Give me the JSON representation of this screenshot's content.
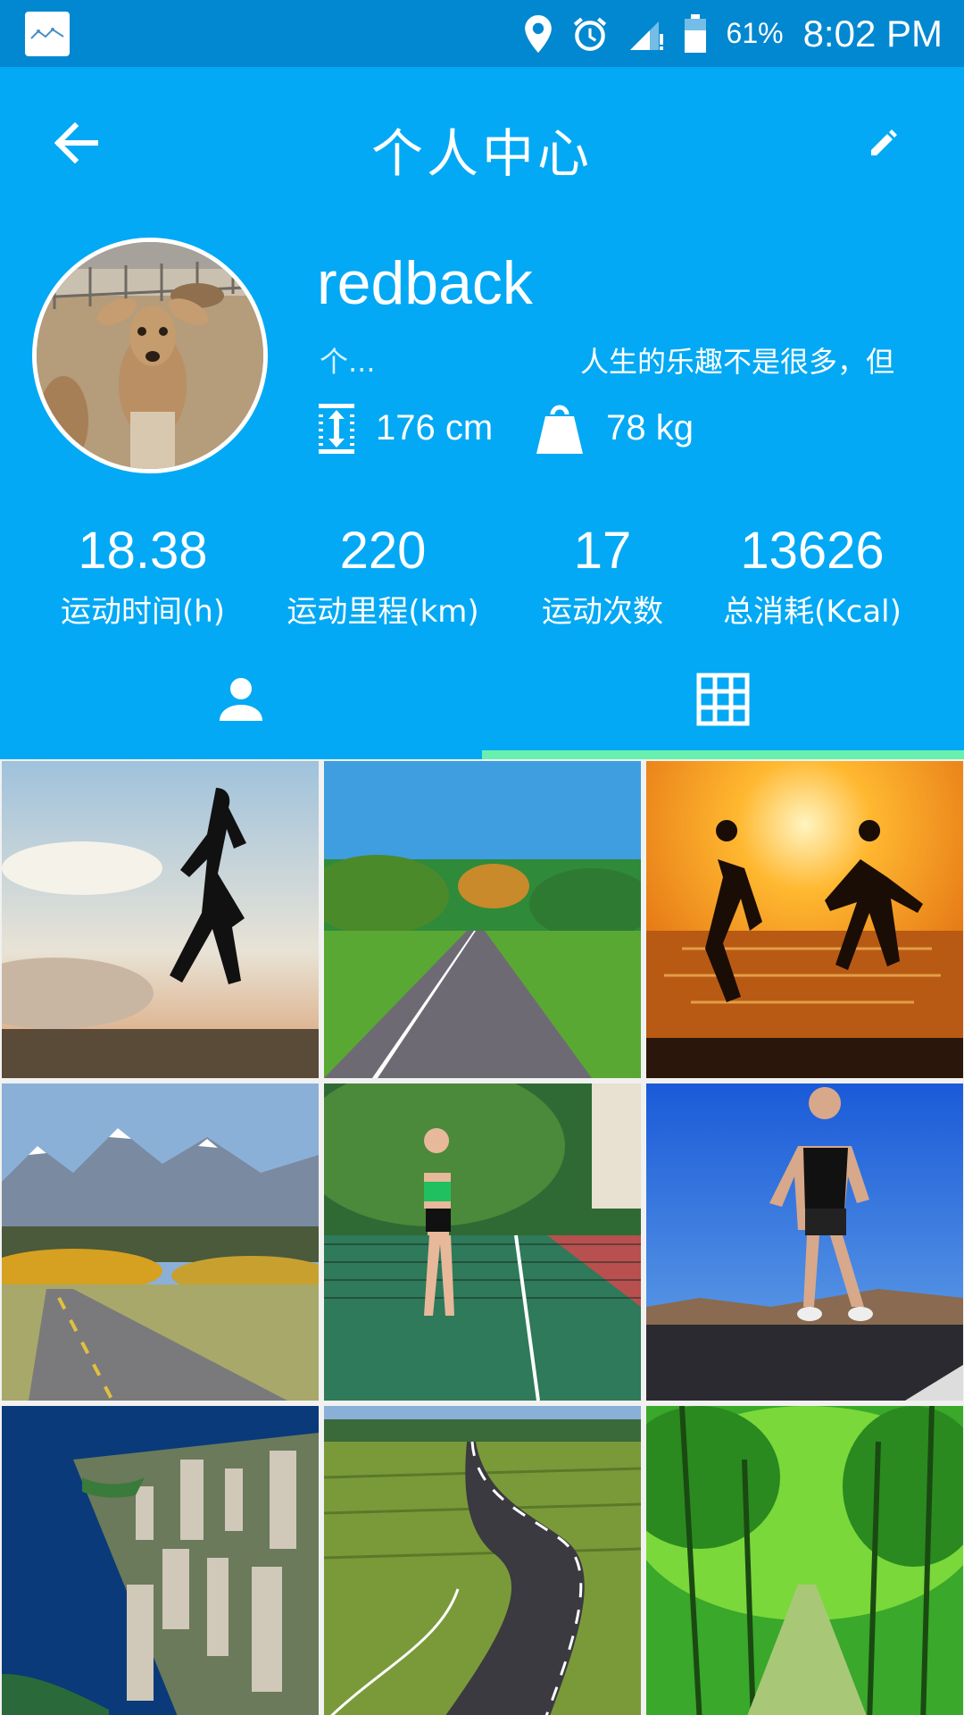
{
  "status_bar": {
    "battery_percent": "61%",
    "time": "8:02 PM"
  },
  "toolbar": {
    "title": "个人中心"
  },
  "profile": {
    "username": "redback",
    "bio_short": "个...",
    "bio_long": "人生的乐趣不是很多，但",
    "height": "176 cm",
    "weight": "78 kg"
  },
  "stats": [
    {
      "value": "18.38",
      "label": "运动时间(h)"
    },
    {
      "value": "220",
      "label": "运动里程(km)"
    },
    {
      "value": "17",
      "label": "运动次数"
    },
    {
      "value": "13626",
      "label": "总消耗(Kcal)"
    }
  ],
  "tabs": [
    {
      "icon": "person-icon",
      "selected": false
    },
    {
      "icon": "grid-icon",
      "selected": true
    }
  ],
  "colors": {
    "status_bar": "#0288d1",
    "primary": "#03a9f4",
    "tab_indicator": "#69f0ae"
  },
  "gallery": [
    {
      "subject": "woman-running-silhouette"
    },
    {
      "subject": "countryside-road"
    },
    {
      "subject": "couple-running-sunset"
    },
    {
      "subject": "mountain-road"
    },
    {
      "subject": "woman-tennis-court"
    },
    {
      "subject": "man-runner-resting"
    },
    {
      "subject": "coastal-city"
    },
    {
      "subject": "winding-road-fields"
    },
    {
      "subject": "green-forest-path"
    }
  ]
}
